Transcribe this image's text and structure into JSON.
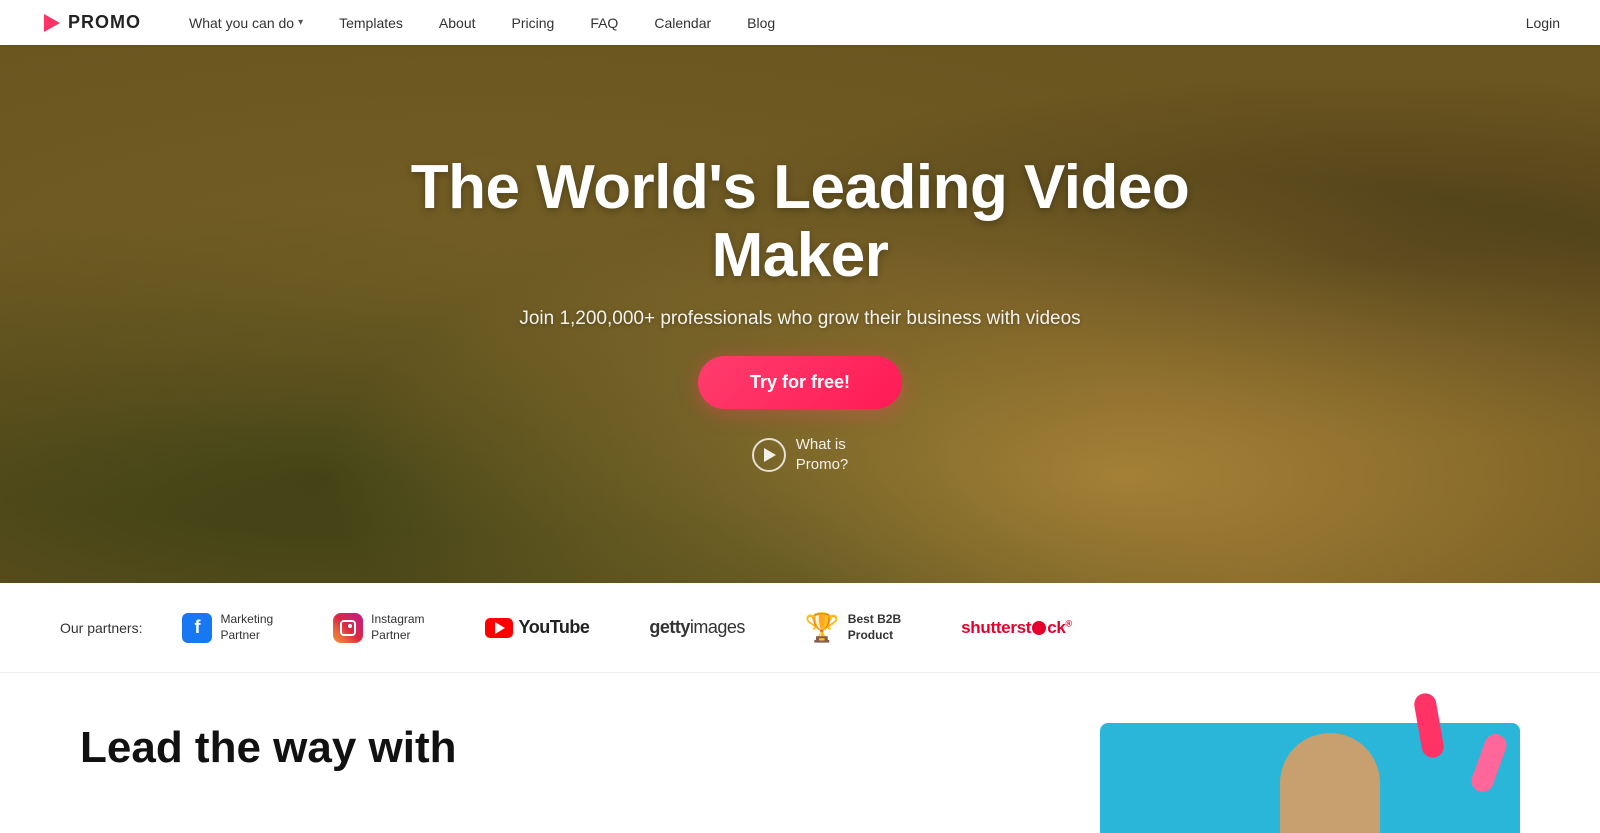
{
  "navbar": {
    "logo_text": "PROMO",
    "nav_items": [
      {
        "id": "what-you-can-do",
        "label": "What you can do",
        "has_dropdown": true
      },
      {
        "id": "templates",
        "label": "Templates",
        "has_dropdown": false
      },
      {
        "id": "about",
        "label": "About",
        "has_dropdown": false
      },
      {
        "id": "pricing",
        "label": "Pricing",
        "has_dropdown": false
      },
      {
        "id": "faq",
        "label": "FAQ",
        "has_dropdown": false
      },
      {
        "id": "calendar",
        "label": "Calendar",
        "has_dropdown": false
      },
      {
        "id": "blog",
        "label": "Blog",
        "has_dropdown": false
      }
    ],
    "login_label": "Login"
  },
  "hero": {
    "title": "The World's Leading Video Maker",
    "subtitle": "Join 1,200,000+ professionals who grow their business with videos",
    "cta_label": "Try for free!",
    "what_is_label": "What is\nPromo?"
  },
  "partners": {
    "label": "Our partners:",
    "items": [
      {
        "id": "facebook",
        "name": "Facebook",
        "sub": "Marketing\nPartner"
      },
      {
        "id": "instagram",
        "name": "Instagram",
        "sub": "Instagram\nPartner"
      },
      {
        "id": "youtube",
        "name": "YouTube",
        "sub": ""
      },
      {
        "id": "getty",
        "name": "gettyimages",
        "sub": ""
      },
      {
        "id": "b2b",
        "name": "Best B2B\nProduct",
        "sub": ""
      },
      {
        "id": "shutterstock",
        "name": "shutterstock",
        "sub": ""
      }
    ]
  },
  "bottom": {
    "heading_line1": "Lead the way with"
  }
}
